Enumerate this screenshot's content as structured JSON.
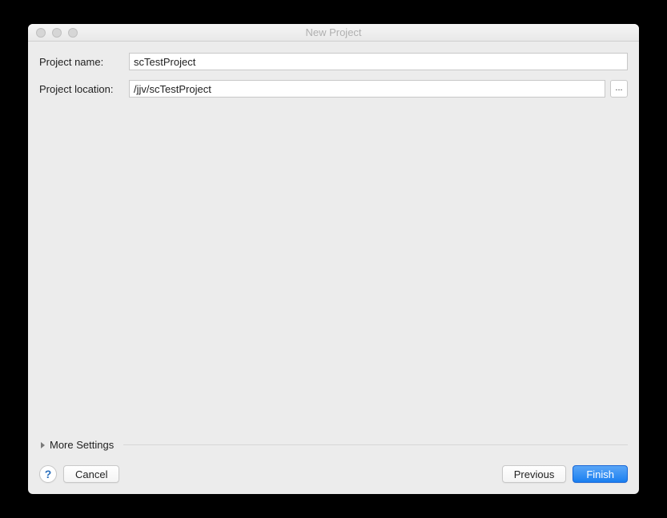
{
  "window": {
    "title": "New Project"
  },
  "form": {
    "name_label": "Project name:",
    "name_value": "scTestProject",
    "location_label": "Project location:",
    "location_value": "/jjv/scTestProject",
    "browse_label": "..."
  },
  "more_settings": {
    "label": "More Settings"
  },
  "footer": {
    "help_label": "?",
    "cancel_label": "Cancel",
    "previous_label": "Previous",
    "finish_label": "Finish"
  }
}
